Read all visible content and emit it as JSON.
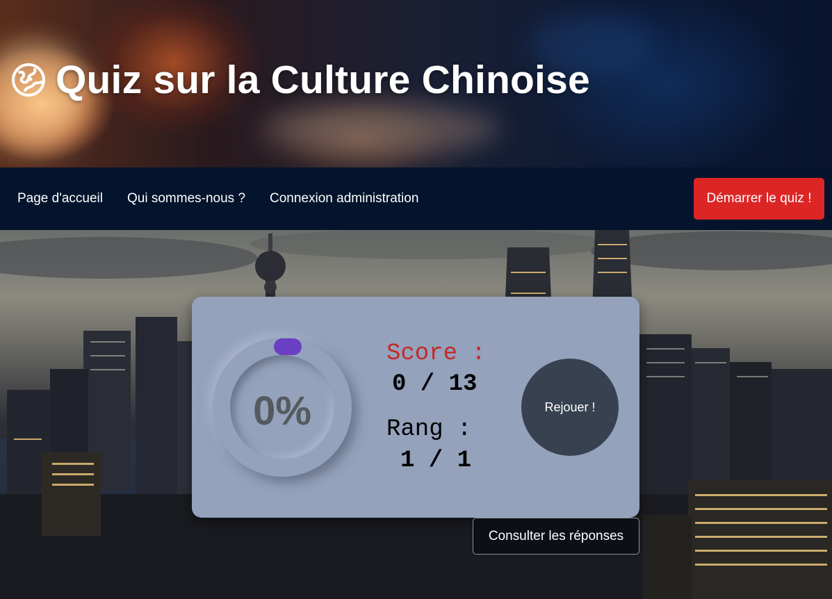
{
  "header": {
    "title": "Quiz sur la Culture Chinoise",
    "logo_icon": "globe-icon"
  },
  "nav": {
    "items": [
      {
        "label": "Page d'accueil"
      },
      {
        "label": "Qui sommes-nous ?"
      },
      {
        "label": "Connexion administration"
      }
    ],
    "start_label": "Démarrer le quiz !"
  },
  "result": {
    "percent_label": "0%",
    "progress": 0,
    "score_label": "Score :",
    "score_value": "0 / 13",
    "rank_label": "Rang :",
    "rank_value": "1 / 1",
    "replay_label": "Rejouer !",
    "answers_label": "Consulter les réponses"
  },
  "colors": {
    "nav_bg": "#03142c",
    "start_btn": "#dc2626",
    "card_bg": "#94a2bb",
    "progress_knob": "#6a3fc4",
    "score_label": "#c62828",
    "replay_btn": "#384150"
  }
}
